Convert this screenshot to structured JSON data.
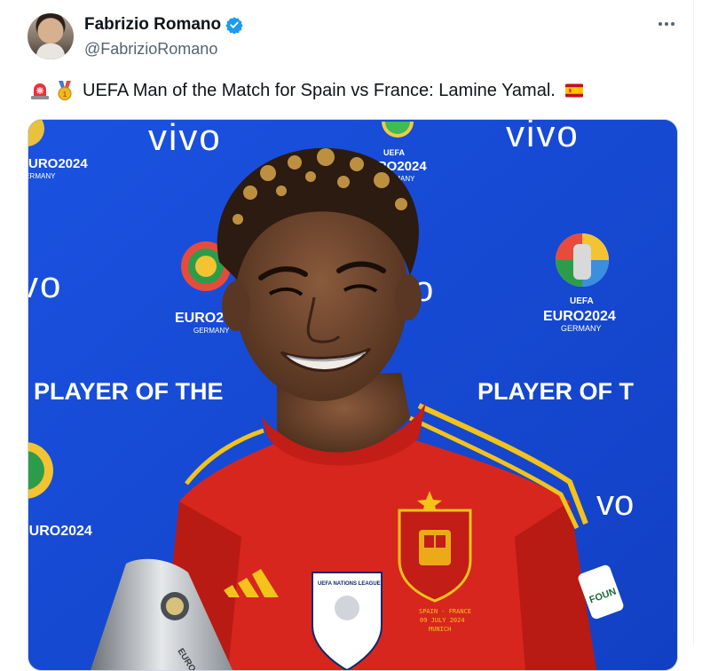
{
  "author": {
    "display_name": "Fabrizio Romano",
    "handle": "@FabrizioRomano",
    "verified": true,
    "verified_color": "#1d9bf0"
  },
  "tweet": {
    "text": "UEFA Man of the Match for Spain vs France: Lamine Yamal.",
    "leading_emojis": [
      "rotating-light",
      "1st-place-medal"
    ],
    "trailing_emoji": "flag-spain"
  },
  "media": {
    "backdrop_brand": "vivo",
    "backdrop_event": "EURO2024",
    "backdrop_country": "GERMANY",
    "backdrop_uefa": "UEFA",
    "backdrop_award": "PLAYER OF THE",
    "backdrop_award_right": "PLAYER OF T",
    "backdrop_color": "#1748d2",
    "jersey_color": "#d7261e",
    "jersey_stripe_color": "#f3c31a",
    "crest_text_1": "SPAIN - FRANCE",
    "crest_text_2": "09 JULY 2024",
    "crest_text_3": "MUNICH",
    "nations_league_badge": "UEFA NATIONS LEAGUE"
  },
  "actions": {
    "more_label": "More"
  }
}
